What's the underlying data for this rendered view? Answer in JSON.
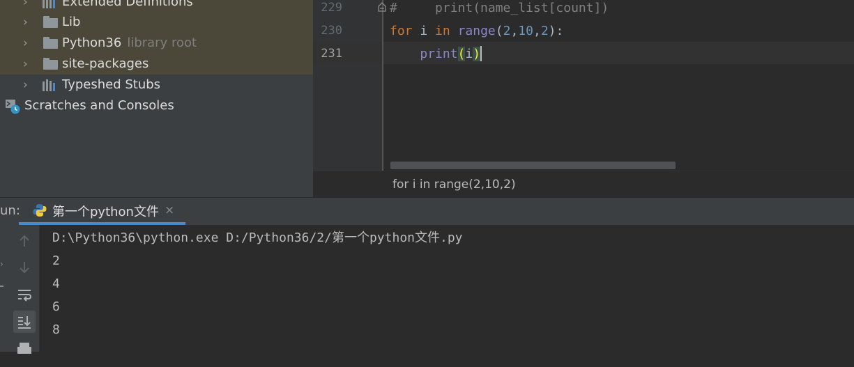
{
  "project_tree": {
    "items": [
      {
        "label": "Extended Definitions",
        "icon": "library-icon"
      },
      {
        "label": "Lib",
        "icon": "folder-icon"
      },
      {
        "label": "Python36",
        "hint": "library root",
        "icon": "folder-icon"
      },
      {
        "label": "site-packages",
        "icon": "folder-icon"
      },
      {
        "label": "Typeshed Stubs",
        "icon": "library-icon"
      },
      {
        "label": "Scratches and Consoles",
        "icon": "scratches-icon"
      }
    ]
  },
  "editor": {
    "line_numbers": [
      "229",
      "230",
      "231"
    ],
    "lines": [
      "#     print(name_list[count])",
      "for i in range(2,10,2):",
      "    print(i)"
    ],
    "breadcrumb": "for i in range(2,10,2)"
  },
  "run_panel": {
    "label": "un:",
    "tab_label": "第一个python文件",
    "close_symbol": "×",
    "command": "D:\\Python36\\python.exe D:/Python36/2/第一个python文件.py",
    "output": [
      "2",
      "4",
      "6",
      "8"
    ]
  },
  "colors": {
    "keyword": "#cc7832",
    "builtin": "#8888c6",
    "number": "#6897bb",
    "accent": "#4a88c7"
  }
}
